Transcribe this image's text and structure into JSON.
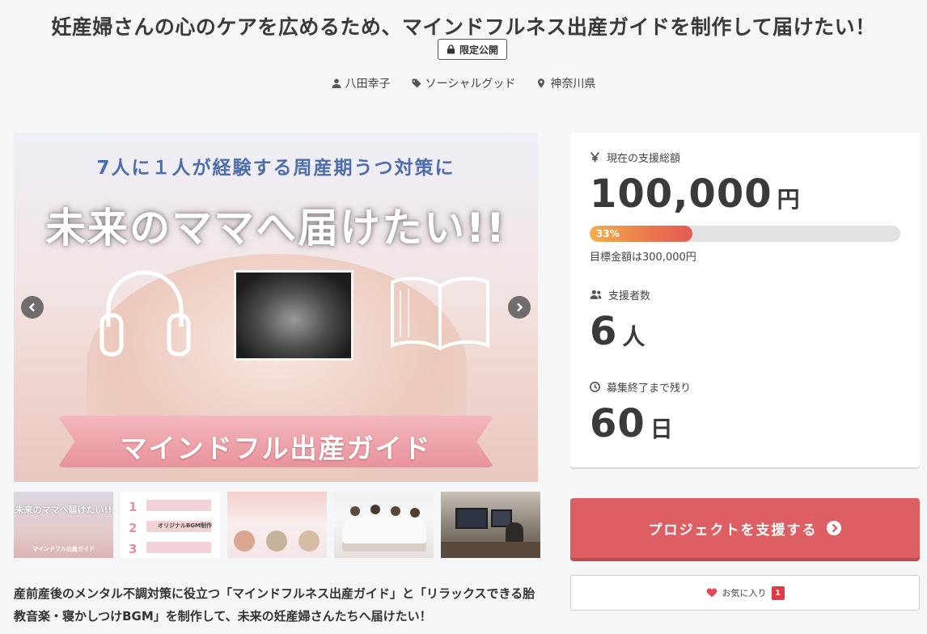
{
  "project": {
    "title": "妊産婦さんの心のケアを広めるため、マインドフルネス出産ガイドを制作して届けたい！",
    "visibility_badge": "限定公開",
    "owner": "八田幸子",
    "category": "ソーシャルグッド",
    "location": "神奈川県"
  },
  "hero": {
    "tagline": "7人に１人が経験する周産期うつ対策に",
    "headline": "未来のママへ届けたい!!",
    "ribbon_text": "マインドフル出産ガイド"
  },
  "thumbnails": [
    {
      "caption": "未来のママへ届けたい!!",
      "sub": "マインドフル出産ガイド",
      "theme": "pink-photo"
    },
    {
      "caption": "1 / 2 / 3",
      "sub": "オリジナルBGM制作",
      "theme": "list"
    },
    {
      "caption": "",
      "sub": "",
      "theme": "people"
    },
    {
      "caption": "",
      "sub": "",
      "theme": "team"
    },
    {
      "caption": "",
      "sub": "",
      "theme": "studio"
    }
  ],
  "stats": {
    "total_label": "現在の支援総額",
    "total_value": "100,000",
    "total_unit": "円",
    "progress_percent": 33,
    "progress_text": "33%",
    "goal_text": "目標金額は300,000円",
    "supporters_label": "支援者数",
    "supporters_value": "6",
    "supporters_unit": "人",
    "remaining_label": "募集終了まで残り",
    "remaining_value": "60",
    "remaining_unit": "日"
  },
  "actions": {
    "support_label": "プロジェクトを支援する",
    "favorite_label": "お気に入り",
    "favorite_count": "1"
  },
  "description": "産前産後のメンタル不調対策に役立つ「マインドフルネス出産ガイド」と「リラックスできる胎教音楽・寝かしつけBGM」を制作して、未来の妊産婦さんたちへ届けたい！",
  "colors": {
    "accent": "#de5f63",
    "progress_start": "#f4b04a",
    "progress_end": "#e45a55",
    "badge_red": "#e23a46"
  }
}
